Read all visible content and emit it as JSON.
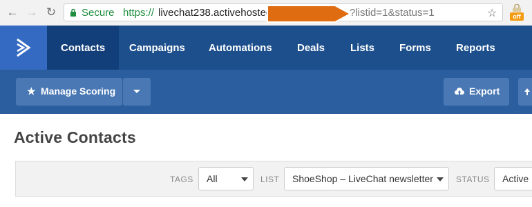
{
  "browser": {
    "secure_label": "Secure",
    "url_scheme": "https://",
    "url_host_visible": "livechat238.activehostec",
    "url_tail_visible": "?listid=1&status=1",
    "extension_badge": "off"
  },
  "nav": {
    "items": [
      {
        "label": "Contacts"
      },
      {
        "label": "Campaigns"
      },
      {
        "label": "Automations"
      },
      {
        "label": "Deals"
      },
      {
        "label": "Lists"
      },
      {
        "label": "Forms"
      },
      {
        "label": "Reports"
      }
    ]
  },
  "toolbar": {
    "manage_scoring_label": "Manage Scoring",
    "export_label": "Export"
  },
  "page": {
    "title": "Active Contacts"
  },
  "filters": {
    "tags_label": "TAGS",
    "tags_value": "All",
    "list_label": "LIST",
    "list_value": "ShoeShop – LiveChat newsletter",
    "status_label": "STATUS",
    "status_value": "Active"
  },
  "colors": {
    "nav_bg": "#1c4f8c",
    "toolbar_bg": "#2b5e9f",
    "accent_logo": "#356ac3",
    "annotation_arrow": "#e06c12"
  }
}
